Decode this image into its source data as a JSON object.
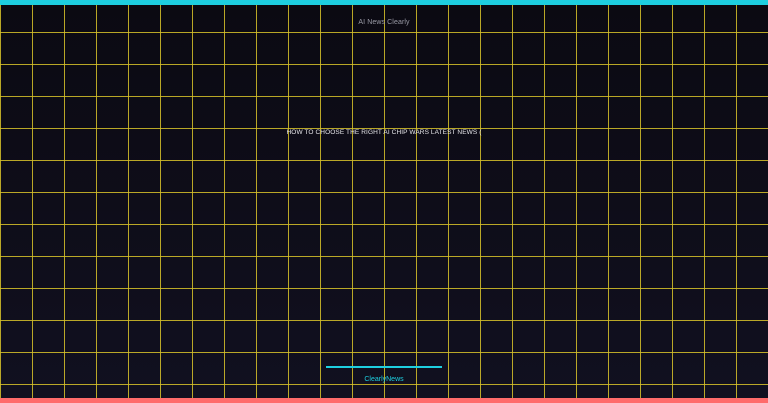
{
  "header": {
    "site_name": "AI News Clearly"
  },
  "main": {
    "headline": "HOW TO CHOOSE THE RIGHT AI CHIP WARS LATEST NEWS ("
  },
  "footer": {
    "brand": "ClearlyNews"
  },
  "colors": {
    "accent_top": "#1ecfe0",
    "accent_bottom": "#ff6b6b",
    "grid_line": "#d8c32a",
    "background": "#0d0c14"
  }
}
